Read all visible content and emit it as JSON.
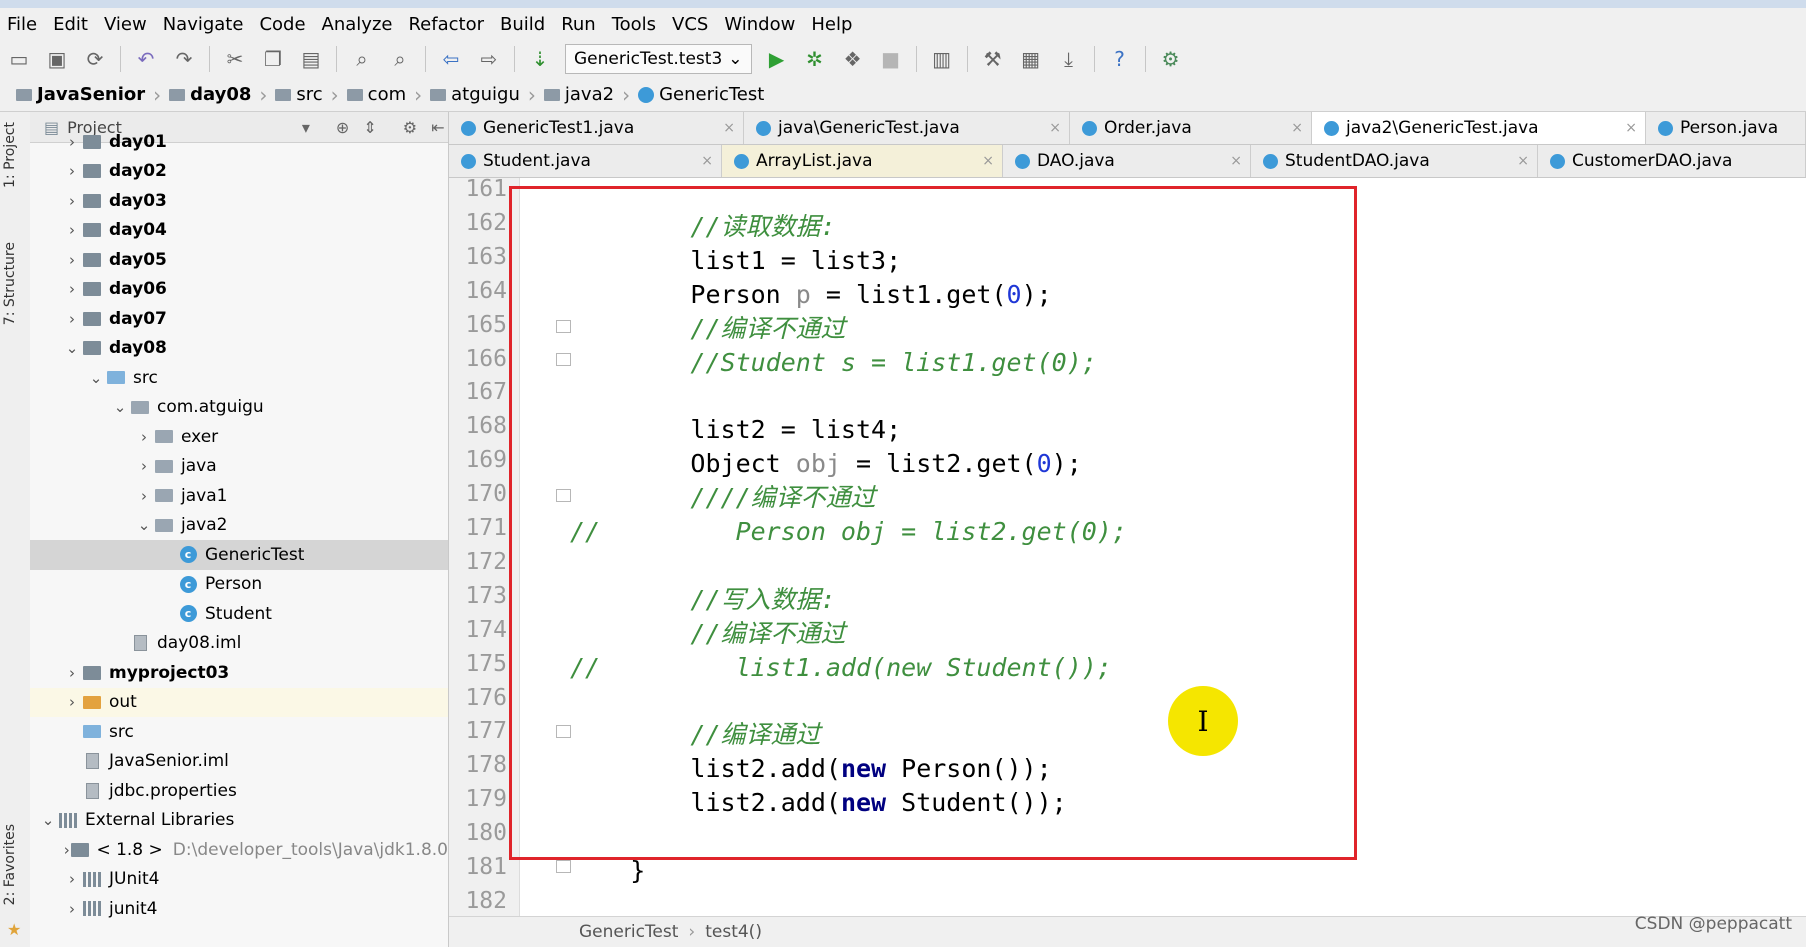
{
  "menu": [
    "File",
    "Edit",
    "View",
    "Navigate",
    "Code",
    "Analyze",
    "Refactor",
    "Build",
    "Run",
    "Tools",
    "VCS",
    "Window",
    "Help"
  ],
  "toolbar": {
    "run_config": "GenericTest.test3",
    "help": "?"
  },
  "breadcrumb": [
    "JavaSenior",
    "day08",
    "src",
    "com",
    "atguigu",
    "java2",
    "GenericTest"
  ],
  "side_tabs": {
    "project": "1: Project",
    "structure": "7: Structure",
    "favorites": "2: Favorites"
  },
  "project_panel": {
    "title": "Project",
    "tree": [
      {
        "label": "day01",
        "bold": true,
        "indent": 0,
        "arrow": "›",
        "icon": "mod"
      },
      {
        "label": "day02",
        "bold": true,
        "indent": 0,
        "arrow": "›",
        "icon": "mod"
      },
      {
        "label": "day03",
        "bold": true,
        "indent": 0,
        "arrow": "›",
        "icon": "mod"
      },
      {
        "label": "day04",
        "bold": true,
        "indent": 0,
        "arrow": "›",
        "icon": "mod"
      },
      {
        "label": "day05",
        "bold": true,
        "indent": 0,
        "arrow": "›",
        "icon": "mod"
      },
      {
        "label": "day06",
        "bold": true,
        "indent": 0,
        "arrow": "›",
        "icon": "mod"
      },
      {
        "label": "day07",
        "bold": true,
        "indent": 0,
        "arrow": "›",
        "icon": "mod"
      },
      {
        "label": "day08",
        "bold": true,
        "indent": 0,
        "arrow": "⌄",
        "icon": "mod"
      },
      {
        "label": "src",
        "indent": 1,
        "arrow": "⌄",
        "icon": "src"
      },
      {
        "label": "com.atguigu",
        "indent": 2,
        "arrow": "⌄",
        "icon": "folder"
      },
      {
        "label": "exer",
        "indent": 3,
        "arrow": "›",
        "icon": "folder"
      },
      {
        "label": "java",
        "indent": 3,
        "arrow": "›",
        "icon": "folder"
      },
      {
        "label": "java1",
        "indent": 3,
        "arrow": "›",
        "icon": "folder"
      },
      {
        "label": "java2",
        "indent": 3,
        "arrow": "⌄",
        "icon": "folder"
      },
      {
        "label": "GenericTest",
        "indent": 4,
        "arrow": "",
        "icon": "class",
        "selected": true
      },
      {
        "label": "Person",
        "indent": 4,
        "arrow": "",
        "icon": "class"
      },
      {
        "label": "Student",
        "indent": 4,
        "arrow": "",
        "icon": "class"
      },
      {
        "label": "day08.iml",
        "indent": 2,
        "arrow": "",
        "icon": "file"
      },
      {
        "label": "myproject03",
        "bold": true,
        "indent": 0,
        "arrow": "›",
        "icon": "mod"
      },
      {
        "label": "out",
        "indent": 0,
        "arrow": "›",
        "icon": "out",
        "highlight": true
      },
      {
        "label": "src",
        "indent": 0,
        "arrow": "",
        "icon": "src"
      },
      {
        "label": "JavaSenior.iml",
        "indent": 0,
        "arrow": "",
        "icon": "file"
      },
      {
        "label": "jdbc.properties",
        "indent": 0,
        "arrow": "",
        "icon": "file"
      },
      {
        "label": "External Libraries",
        "indent": -1,
        "arrow": "⌄",
        "icon": "lib"
      },
      {
        "label": "< 1.8 >",
        "extra": "D:\\developer_tools\\Java\\jdk1.8.0",
        "indent": 0,
        "arrow": "›",
        "icon": "mod"
      },
      {
        "label": "JUnit4",
        "indent": 0,
        "arrow": "›",
        "icon": "lib"
      },
      {
        "label": "junit4",
        "indent": 0,
        "arrow": "›",
        "icon": "lib"
      }
    ]
  },
  "tabs_row1": [
    {
      "label": "GenericTest1.java"
    },
    {
      "label": "java\\GenericTest.java"
    },
    {
      "label": "Order.java"
    },
    {
      "label": "java2\\GenericTest.java",
      "active": true
    },
    {
      "label": "Person.java"
    }
  ],
  "tabs_row2": [
    {
      "label": "Student.java"
    },
    {
      "label": "ArrayList.java",
      "yellow": true
    },
    {
      "label": "DAO.java"
    },
    {
      "label": "StudentDAO.java"
    },
    {
      "label": "CustomerDAO.java"
    }
  ],
  "code": [
    {
      "n": "161",
      "t": []
    },
    {
      "n": "162",
      "t": [
        [
          "c",
          "        //读取数据:"
        ]
      ]
    },
    {
      "n": "163",
      "t": [
        [
          "p",
          "        list1 = list3;"
        ]
      ]
    },
    {
      "n": "164",
      "t": [
        [
          "p",
          "        Person "
        ],
        [
          "u",
          "p"
        ],
        [
          "p",
          " = list1.get("
        ],
        [
          "num",
          "0"
        ],
        [
          "p",
          ");"
        ]
      ]
    },
    {
      "n": "165",
      "t": [
        [
          "c",
          "        //编译不通过"
        ]
      ]
    },
    {
      "n": "166",
      "t": [
        [
          "c",
          "        //Student s = list1.get(0);"
        ]
      ]
    },
    {
      "n": "167",
      "t": []
    },
    {
      "n": "168",
      "t": [
        [
          "p",
          "        list2 = list4;"
        ]
      ]
    },
    {
      "n": "169",
      "t": [
        [
          "p",
          "        Object "
        ],
        [
          "u",
          "obj"
        ],
        [
          "p",
          " = list2.get("
        ],
        [
          "num",
          "0"
        ],
        [
          "p",
          ");"
        ]
      ]
    },
    {
      "n": "170",
      "t": [
        [
          "c",
          "        ////编译不通过"
        ]
      ]
    },
    {
      "n": "171",
      "t": [
        [
          "c",
          "//         Person obj = list2.get(0);"
        ]
      ]
    },
    {
      "n": "172",
      "t": []
    },
    {
      "n": "173",
      "t": [
        [
          "c",
          "        //写入数据:"
        ]
      ]
    },
    {
      "n": "174",
      "t": [
        [
          "c",
          "        //编译不通过"
        ]
      ]
    },
    {
      "n": "175",
      "t": [
        [
          "c",
          "//         list1.add(new Student());"
        ]
      ]
    },
    {
      "n": "176",
      "t": []
    },
    {
      "n": "177",
      "t": [
        [
          "c",
          "        //编译通过"
        ]
      ]
    },
    {
      "n": "178",
      "t": [
        [
          "p",
          "        list2.add("
        ],
        [
          "k",
          "new"
        ],
        [
          "p",
          " Person());"
        ]
      ]
    },
    {
      "n": "179",
      "t": [
        [
          "p",
          "        list2.add("
        ],
        [
          "k",
          "new"
        ],
        [
          "p",
          " Student());"
        ]
      ]
    },
    {
      "n": "180",
      "t": []
    },
    {
      "n": "181",
      "t": [
        [
          "p",
          "    }"
        ]
      ]
    },
    {
      "n": "182",
      "t": []
    }
  ],
  "status": {
    "class": "GenericTest",
    "method": "test4()"
  },
  "watermark": "CSDN @peppacatt",
  "cursor_glyph": "I",
  "colors": {
    "highlight_box": "#e0242a",
    "comment": "#3f8f3f",
    "keyword": "#000080",
    "number": "#1f37d6",
    "cursor": "#f5e600"
  }
}
